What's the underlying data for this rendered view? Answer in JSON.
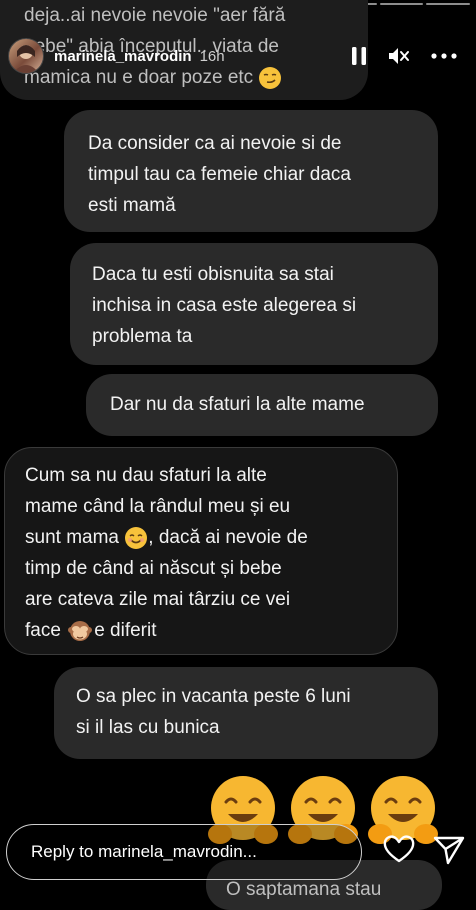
{
  "story": {
    "username": "marinela_mavrodin",
    "time": "16h",
    "segments": 10
  },
  "messages": {
    "top_lines": [
      "deja..ai nevoie nevoie \"aer fără",
      "bebe\" abia începutul.. viata de",
      "mamica nu e doar poze etc"
    ],
    "m1_lines": [
      "Da consider ca ai nevoie si de",
      "timpul tau ca femeie chiar daca",
      "esti mamă"
    ],
    "m2_lines": [
      "Daca tu esti obisnuita sa stai",
      "inchisa in casa este alegerea si",
      "problema ta"
    ],
    "m3": "Dar nu da sfaturi la alte mame",
    "m4_lines": [
      "Cum sa nu dau sfaturi la alte",
      "mame când la rândul meu și eu",
      "sunt mama",
      ", dacă ai nevoie de",
      "timp de când ai născut și bebe",
      "are cateva zile mai târziu ce vei",
      "face",
      "e diferit"
    ],
    "m5_lines": [
      "O sa plec in vacanta peste 6 luni",
      "si il las cu bunica"
    ],
    "m6": "O saptamana stau"
  },
  "reply": {
    "placeholder": "Reply to marinela_mavrodin..."
  },
  "icons": {
    "pause": "pause-icon",
    "mute": "speaker-muted-icon",
    "more": "more-options-icon",
    "heart": "heart-icon",
    "send": "send-icon",
    "emoji_hug": "hugging-face-emoji",
    "emoji_smiling": "smiling-face-emoji",
    "emoji_monkey": "see-no-evil-monkey-emoji",
    "emoji_smirk": "smirking-face-emoji"
  },
  "colors": {
    "bubble": "#2a2a2a",
    "background": "#000000",
    "text": "#f2f2f2"
  }
}
